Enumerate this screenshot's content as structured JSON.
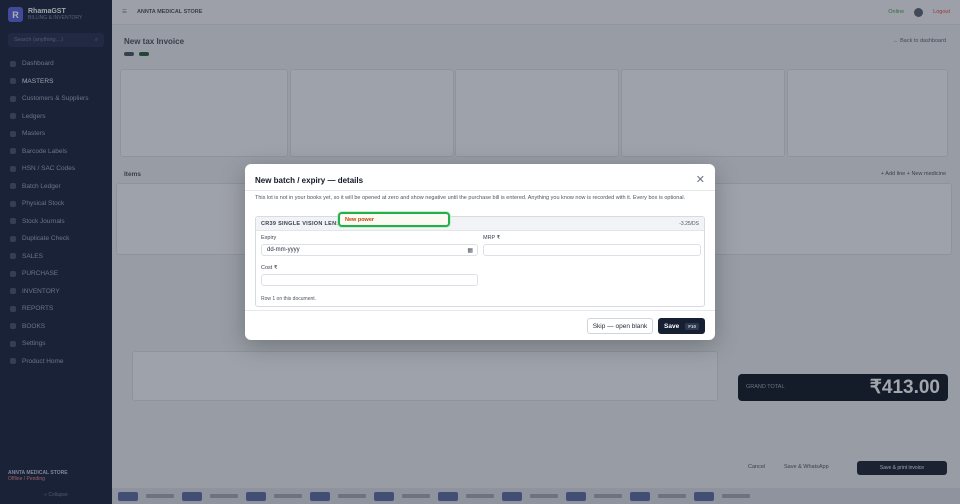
{
  "sidebar": {
    "brand_initial": "R",
    "brand_name": "RhamaGST",
    "brand_sub": "BILLING & INVENTORY",
    "search_placeholder": "Search (anything…)",
    "items": [
      {
        "label": "Dashboard"
      },
      {
        "label": "MASTERS"
      },
      {
        "label": "Customers & Suppliers"
      },
      {
        "label": "Ledgers"
      },
      {
        "label": "Masters"
      },
      {
        "label": "Barcode Labels"
      },
      {
        "label": "HSN / SAC Codes"
      },
      {
        "label": "Batch Ledger"
      },
      {
        "label": "Physical Stock"
      },
      {
        "label": "Stock Journals"
      },
      {
        "label": "Duplicate Check"
      },
      {
        "label": "SALES"
      },
      {
        "label": "PURCHASE"
      },
      {
        "label": "INVENTORY"
      },
      {
        "label": "REPORTS"
      },
      {
        "label": "BOOKS"
      },
      {
        "label": "Settings"
      },
      {
        "label": "Product Home"
      }
    ],
    "footer_store": "ANNTA MEDICAL STORE",
    "footer_offline": "Offline / Pending",
    "footer_collapse": "« Collapse"
  },
  "topbar": {
    "store": "ANNTA MEDICAL STORE",
    "online": "Online",
    "logout": "Logout"
  },
  "main": {
    "page_title": "New tax Invoice",
    "back_link": "← Back to dashboard",
    "items_title": "Items",
    "items_actions": "+ Add line   + New medicine",
    "grand_label": "GRAND TOTAL",
    "grand_amount": "₹413.00",
    "cancel": "Cancel",
    "whatsapp": "Save & WhatsApp",
    "save_print": "Save & print invoice"
  },
  "modal": {
    "title": "New batch / expiry — details",
    "close": "✕",
    "description": "This lot is not in your books yet, so it will be opened at zero and show negative until the purchase bill is entered. Anything you know now is recorded with it. Every box is optional.",
    "lot_name": "CR39 SINGLE VISION LENS",
    "lot_power": "-3.25/DS",
    "new_power_label": "New power",
    "expiry_label": "Expiry",
    "expiry_placeholder": "dd-mm-yyyy",
    "mrp_label": "MRP ₹",
    "cost_label": "Cost ₹",
    "row_note": "Row 1 on this document.",
    "skip_label": "Skip — open blank",
    "save_label": "Save",
    "save_shortcut": "F10"
  }
}
